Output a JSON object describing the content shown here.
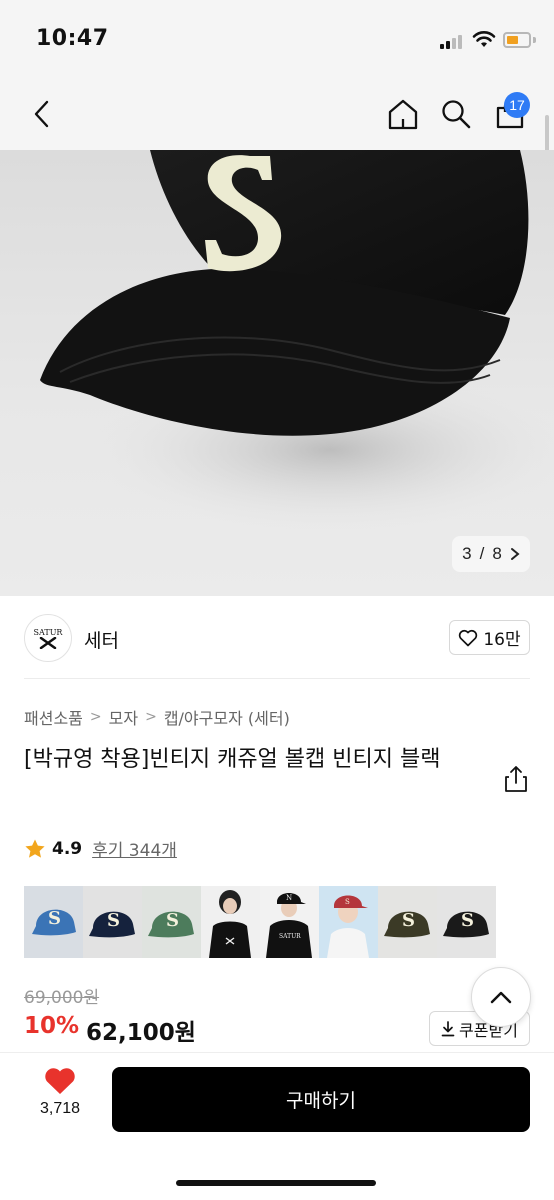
{
  "status_bar": {
    "time": "10:47"
  },
  "nav": {
    "cart_count": "17"
  },
  "image_counter": {
    "current": "3",
    "separator": "/",
    "total": "8"
  },
  "shop": {
    "logo_text": "SATUR",
    "name": "세터",
    "like_count": "16만"
  },
  "breadcrumb": [
    "패션소품",
    "모자",
    "캡/야구모자 (세터)"
  ],
  "product": {
    "title": "[박규영 착용]빈티지 캐쥬얼 볼캡 빈티지 블랙",
    "rating": "4.9",
    "reviews": "후기 344개",
    "original_price": "69,000원",
    "discount_rate": "10%",
    "sale_price": "62,100원"
  },
  "thumbnails": [
    {
      "name": "blue-cap",
      "color": "#3b74b6"
    },
    {
      "name": "navy-cap",
      "color": "#15223d"
    },
    {
      "name": "green-cap",
      "color": "#4d7c5c"
    },
    {
      "name": "model-black-tee",
      "color": "#1a1a1a"
    },
    {
      "name": "model-black-cap",
      "color": "#111111"
    },
    {
      "name": "model-red-cap",
      "color": "#b4363c"
    },
    {
      "name": "olive-cap",
      "color": "#3b3a26"
    },
    {
      "name": "black-cap",
      "color": "#1a1a1a"
    }
  ],
  "coupon": {
    "label": "쿠폰받기"
  },
  "bottom": {
    "wish_count": "3,718",
    "buy_label": "구매하기"
  },
  "colors": {
    "accent_red": "#e8332c",
    "badge_blue": "#2f7bf5",
    "buy_black": "#000000"
  }
}
